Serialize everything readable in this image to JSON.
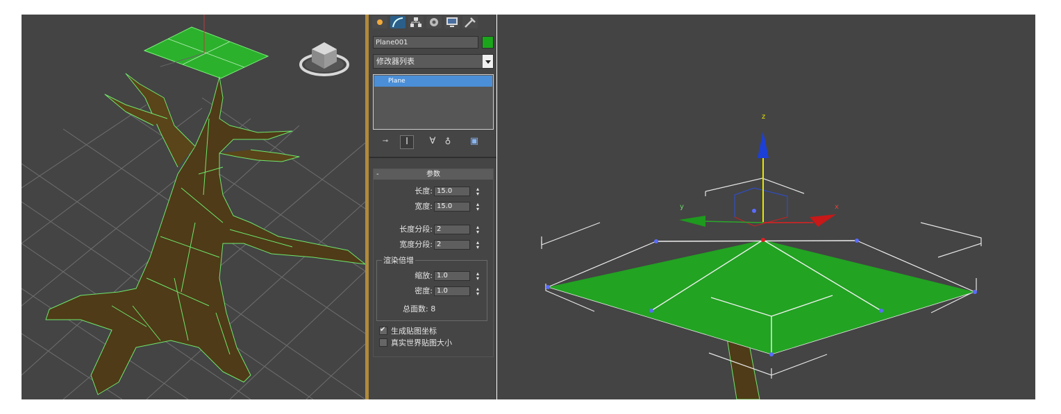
{
  "panel": {
    "tabs": [
      "create-tab",
      "modify-tab",
      "hierarchy-tab",
      "motion-tab",
      "display-tab",
      "utilities-tab"
    ],
    "object_name": "Plane001",
    "object_color": "#1ba51b",
    "modifier_list": "修改器列表",
    "stack_item": "Plane",
    "stack_buttons": [
      "pin-stack-icon",
      "show-end-result-icon",
      "make-unique-icon",
      "remove-modifier-icon",
      "configure-sets-icon"
    ],
    "rollout_title": "参数",
    "length_label": "长度:",
    "length_value": "15.0",
    "width_label": "宽度:",
    "width_value": "15.0",
    "length_segs_label": "长度分段:",
    "length_segs_value": "2",
    "width_segs_label": "宽度分段:",
    "width_segs_value": "2",
    "render_group_label": "渲染倍增",
    "scale_label": "缩放:",
    "scale_value": "1.0",
    "density_label": "密度:",
    "density_value": "1.0",
    "total_faces": "总面数: 8",
    "gen_mapping_label": "生成贴图坐标",
    "gen_mapping_checked": true,
    "real_world_label": "真实世界贴图大小",
    "real_world_checked": false
  },
  "viewport_right": {
    "axis_x": "x",
    "axis_y": "y",
    "axis_z": "z"
  },
  "colors": {
    "viewport_bg": "#444444",
    "panel_bg": "#454545",
    "plane_green": "#24a624",
    "selection_blue": "#4a8fd8"
  }
}
